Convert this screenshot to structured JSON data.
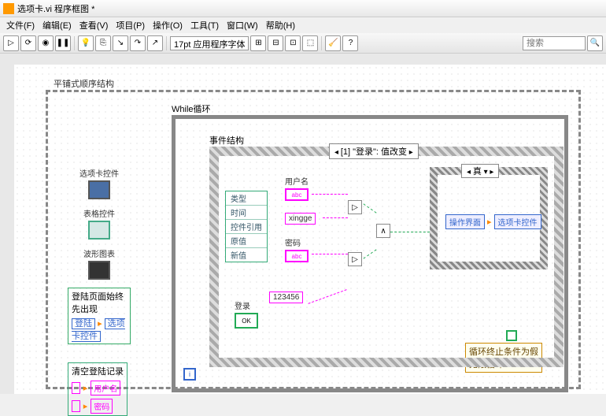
{
  "window": {
    "title": "选项卡.vi 程序框图 *"
  },
  "menu": {
    "file": "文件(F)",
    "edit": "编辑(E)",
    "view": "查看(V)",
    "project": "项目(P)",
    "operate": "操作(O)",
    "tools": "工具(T)",
    "window": "窗口(W)",
    "help": "帮助(H)"
  },
  "toolbar": {
    "font": "17pt 应用程序字体",
    "search_ph": "搜索"
  },
  "seq": {
    "label": "平铺式顺序结构"
  },
  "while": {
    "label": "While循环"
  },
  "event": {
    "label": "事件结构",
    "selector": "[1] \"登录\": 值改变"
  },
  "terms": {
    "type": "类型",
    "time": "时间",
    "ctrlref": "控件引用",
    "oldval": "原值",
    "newval": "新值"
  },
  "palette": {
    "tab": "选项卡控件",
    "table": "表格控件",
    "chart": "波形图表",
    "login_first": "登陆页面始终先出现",
    "login": "登陆",
    "tab2": "选项卡控件",
    "clear": "清空登陆记录",
    "user": "用户名",
    "pwd": "密码"
  },
  "ctrls": {
    "user_lbl": "用户名",
    "user_const": "xingge",
    "pwd_lbl": "密码",
    "pwd_const": "123456",
    "login_lbl": "登录",
    "abc": "abc",
    "ok": "OK"
  },
  "case": {
    "sel": "真",
    "op_ui": "操作界面",
    "tab": "选项卡控件"
  },
  "cond": {
    "line1": "循环终止条件为假",
    "line2": "无限循环"
  },
  "iter": "i"
}
